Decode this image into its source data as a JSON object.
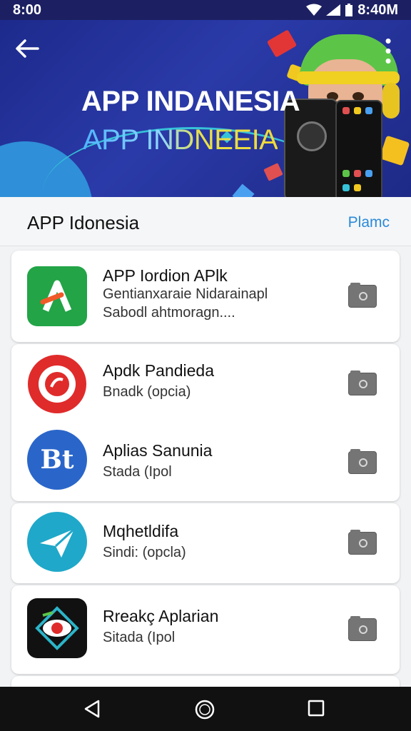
{
  "status_bar": {
    "time": "8:00",
    "clock_right": "8:40M"
  },
  "banner": {
    "title": "APP INDANESIA",
    "subtitle": "APP INDNEEIA"
  },
  "section": {
    "title": "APP Idonesia",
    "action_label": "Plamc"
  },
  "apps": [
    {
      "name": "APP Iordion APlk",
      "desc_line1": "Gentianxaraie Nidarainapl",
      "desc_line2": "Sabodl ahtmoragn....",
      "icon": "green-arrow-icon",
      "icon_bg": "#22a447"
    },
    {
      "name": "Apdk Pandieda",
      "desc_line1": "Bnadk (opcia)",
      "icon": "red-target-icon",
      "icon_bg": "#e02b2b"
    },
    {
      "name": "Aplias Sanunia",
      "desc_line1": "Stada (Ipol",
      "icon": "bt-logo-icon",
      "icon_bg": "#2a66c9"
    },
    {
      "name": "Mqhetldifa",
      "desc_line1": "Sindi: (opcla)",
      "icon": "paper-plane-icon",
      "icon_bg": "#1fa8c9"
    },
    {
      "name": "Rreakç Aplarian",
      "desc_line1": "Sitada (Ipol",
      "icon": "eye-diamond-icon",
      "icon_bg": "#111111"
    }
  ],
  "colors": {
    "banner_bg": "#1d2a8c",
    "accent": "#2a8ad8",
    "folder_icon": "#757575"
  }
}
